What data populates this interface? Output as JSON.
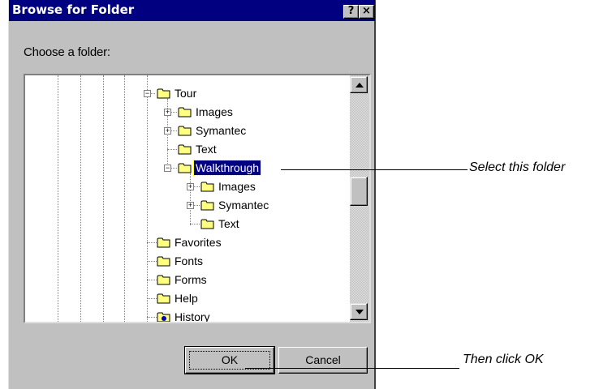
{
  "dialog": {
    "title": "Browse for Folder",
    "help_label": "?",
    "close_label": "×",
    "prompt": "Choose a folder:",
    "ok_label": "OK",
    "cancel_label": "Cancel"
  },
  "tree": {
    "items": [
      {
        "label": "Tour",
        "expander": "−",
        "expanded": true
      },
      {
        "label": "Images",
        "expander": "+"
      },
      {
        "label": "Symantec",
        "expander": "+"
      },
      {
        "label": "Text",
        "expander": ""
      },
      {
        "label": "Walkthrough",
        "expander": "−",
        "selected": true
      },
      {
        "label": "Images",
        "expander": "+"
      },
      {
        "label": "Symantec",
        "expander": "+"
      },
      {
        "label": "Text",
        "expander": ""
      },
      {
        "label": "Favorites",
        "expander": ""
      },
      {
        "label": "Fonts",
        "expander": ""
      },
      {
        "label": "Forms",
        "expander": ""
      },
      {
        "label": "Help",
        "expander": ""
      },
      {
        "label": "History",
        "expander": ""
      }
    ]
  },
  "callouts": {
    "select_folder": "Select this folder",
    "click_ok": "Then click OK"
  },
  "colors": {
    "titlebar": "#000080",
    "dialog_bg": "#c0c0c0",
    "selection": "#000080",
    "folder": "#ffff80"
  }
}
